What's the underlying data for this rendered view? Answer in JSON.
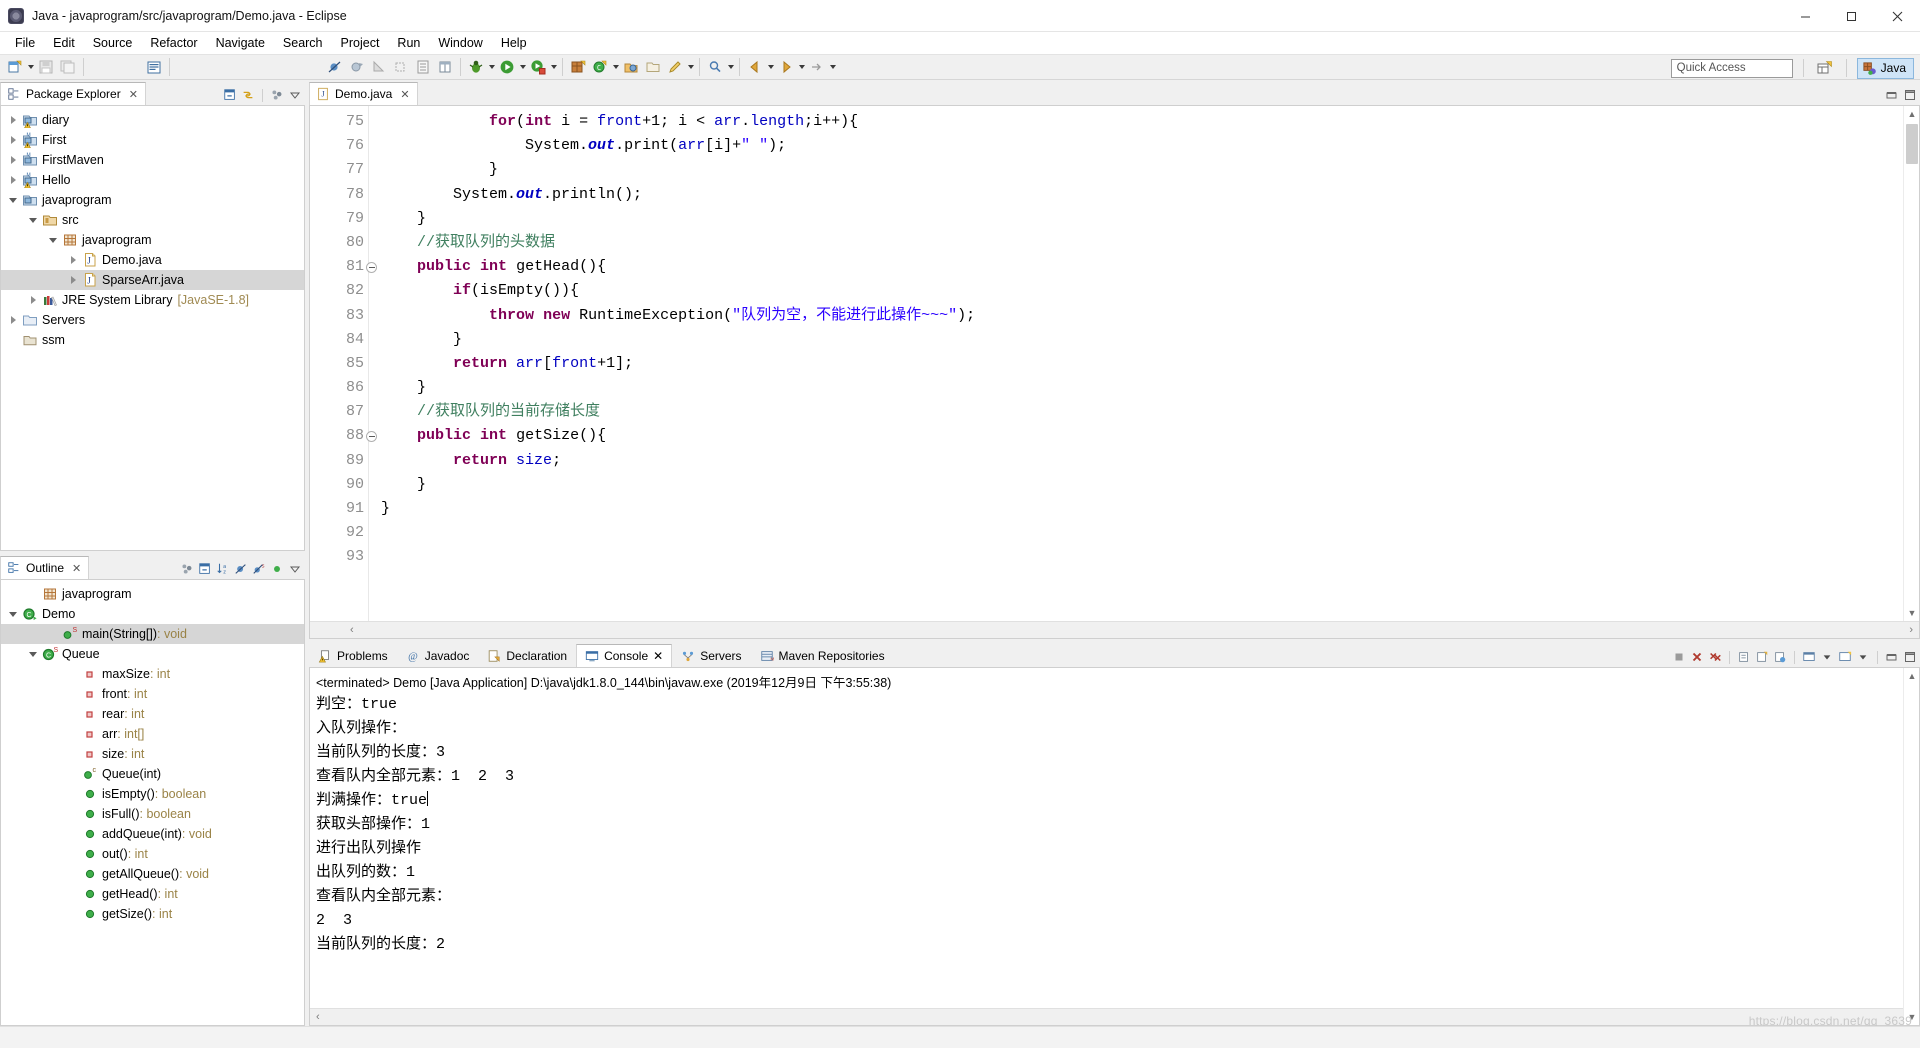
{
  "window": {
    "title": "Java - javaprogram/src/javaprogram/Demo.java - Eclipse",
    "app_icon": "eclipse-icon",
    "minimize": "minimize-button",
    "maximize": "maximize-button",
    "close": "close-button"
  },
  "menubar": {
    "items": [
      "File",
      "Edit",
      "Source",
      "Refactor",
      "Navigate",
      "Search",
      "Project",
      "Run",
      "Window",
      "Help"
    ]
  },
  "toolbar": {
    "quick_access_placeholder": "Quick Access",
    "quick_access_value": "",
    "perspective_open_label": "open-perspective",
    "perspective_java_label": "Java"
  },
  "package_explorer": {
    "tab_label": "Package Explorer",
    "tree": [
      {
        "label": "diary",
        "indent": 0,
        "twist": "closed",
        "icon": "java-project-warning-icon"
      },
      {
        "label": "First",
        "indent": 0,
        "twist": "closed",
        "icon": "maven-project-warning-icon"
      },
      {
        "label": "FirstMaven",
        "indent": 0,
        "twist": "closed",
        "icon": "maven-project-icon"
      },
      {
        "label": "Hello",
        "indent": 0,
        "twist": "closed",
        "icon": "maven-project-warning-icon"
      },
      {
        "label": "javaprogram",
        "indent": 0,
        "twist": "open",
        "icon": "java-project-icon"
      },
      {
        "label": "src",
        "indent": 1,
        "twist": "open",
        "icon": "source-folder-icon"
      },
      {
        "label": "javaprogram",
        "indent": 2,
        "twist": "open",
        "icon": "package-icon"
      },
      {
        "label": "Demo.java",
        "indent": 3,
        "twist": "closed",
        "icon": "java-file-icon"
      },
      {
        "label": "SparseArr.java",
        "indent": 3,
        "twist": "closed",
        "icon": "java-file-icon",
        "selected": true
      },
      {
        "label": "JRE System Library",
        "indent": 1,
        "twist": "closed",
        "icon": "library-icon",
        "sub": "[JavaSE-1.8]"
      },
      {
        "label": "Servers",
        "indent": 0,
        "twist": "closed",
        "icon": "folder-icon"
      },
      {
        "label": "ssm",
        "indent": 0,
        "twist": "none",
        "icon": "closed-project-icon"
      }
    ]
  },
  "outline": {
    "tab_label": "Outline",
    "tree": [
      {
        "label": "javaprogram",
        "indent": 1,
        "twist": "none",
        "icon": "package-icon"
      },
      {
        "label": "Demo",
        "indent": 0,
        "twist": "open",
        "icon": "class-icon"
      },
      {
        "label": "main(String[])",
        "type": " : void",
        "indent": 2,
        "twist": "none",
        "icon": "public-static-method-icon",
        "selected": true
      },
      {
        "label": "Queue",
        "indent": 1,
        "twist": "open",
        "icon": "static-class-icon"
      },
      {
        "label": "maxSize",
        "type": " : int",
        "indent": 3,
        "twist": "none",
        "icon": "private-field-icon"
      },
      {
        "label": "front",
        "type": " : int",
        "indent": 3,
        "twist": "none",
        "icon": "private-field-icon"
      },
      {
        "label": "rear",
        "type": " : int",
        "indent": 3,
        "twist": "none",
        "icon": "private-field-icon"
      },
      {
        "label": "arr",
        "type": " : int[]",
        "indent": 3,
        "twist": "none",
        "icon": "private-field-icon"
      },
      {
        "label": "size",
        "type": " : int",
        "indent": 3,
        "twist": "none",
        "icon": "private-field-icon"
      },
      {
        "label": "Queue(int)",
        "type": "",
        "indent": 3,
        "twist": "none",
        "icon": "constructor-icon"
      },
      {
        "label": "isEmpty()",
        "type": " : boolean",
        "indent": 3,
        "twist": "none",
        "icon": "public-method-icon"
      },
      {
        "label": "isFull()",
        "type": " : boolean",
        "indent": 3,
        "twist": "none",
        "icon": "public-method-icon"
      },
      {
        "label": "addQueue(int)",
        "type": " : void",
        "indent": 3,
        "twist": "none",
        "icon": "public-method-icon"
      },
      {
        "label": "out()",
        "type": " : int",
        "indent": 3,
        "twist": "none",
        "icon": "public-method-icon"
      },
      {
        "label": "getAllQueue()",
        "type": " : void",
        "indent": 3,
        "twist": "none",
        "icon": "public-method-icon"
      },
      {
        "label": "getHead()",
        "type": " : int",
        "indent": 3,
        "twist": "none",
        "icon": "public-method-icon"
      },
      {
        "label": "getSize()",
        "type": " : int",
        "indent": 3,
        "twist": "none",
        "icon": "public-method-icon"
      }
    ]
  },
  "editor": {
    "tab_label": "Demo.java",
    "first_line": 75,
    "lines": [
      {
        "n": 75,
        "fold": false,
        "tokens": [
          {
            "t": "            ",
            "c": "plain"
          },
          {
            "t": "for",
            "c": "kw"
          },
          {
            "t": "(",
            "c": "plain"
          },
          {
            "t": "int",
            "c": "kw"
          },
          {
            "t": " i = ",
            "c": "plain"
          },
          {
            "t": "front",
            "c": "fld"
          },
          {
            "t": "+1; i < ",
            "c": "plain"
          },
          {
            "t": "arr",
            "c": "fld"
          },
          {
            "t": ".",
            "c": "plain"
          },
          {
            "t": "length",
            "c": "fld"
          },
          {
            "t": ";i++){",
            "c": "plain"
          }
        ]
      },
      {
        "n": 76,
        "fold": false,
        "tokens": [
          {
            "t": "                System.",
            "c": "plain"
          },
          {
            "t": "out",
            "c": "stat"
          },
          {
            "t": ".print(",
            "c": "plain"
          },
          {
            "t": "arr",
            "c": "fld"
          },
          {
            "t": "[i]+",
            "c": "plain"
          },
          {
            "t": "\" \"",
            "c": "str"
          },
          {
            "t": ");",
            "c": "plain"
          }
        ]
      },
      {
        "n": 77,
        "fold": false,
        "tokens": [
          {
            "t": "            }",
            "c": "plain"
          }
        ]
      },
      {
        "n": 78,
        "fold": false,
        "tokens": [
          {
            "t": "        System.",
            "c": "plain"
          },
          {
            "t": "out",
            "c": "stat"
          },
          {
            "t": ".println();",
            "c": "plain"
          }
        ]
      },
      {
        "n": 79,
        "fold": false,
        "tokens": [
          {
            "t": "    }",
            "c": "plain"
          }
        ]
      },
      {
        "n": 80,
        "fold": false,
        "tokens": [
          {
            "t": "    //获取队列的头数据",
            "c": "cm"
          }
        ]
      },
      {
        "n": 81,
        "fold": true,
        "tokens": [
          {
            "t": "    ",
            "c": "plain"
          },
          {
            "t": "public",
            "c": "kw"
          },
          {
            "t": " ",
            "c": "plain"
          },
          {
            "t": "int",
            "c": "kw"
          },
          {
            "t": " getHead(){",
            "c": "plain"
          }
        ]
      },
      {
        "n": 82,
        "fold": false,
        "tokens": [
          {
            "t": "        ",
            "c": "plain"
          },
          {
            "t": "if",
            "c": "kw"
          },
          {
            "t": "(isEmpty()){",
            "c": "plain"
          }
        ]
      },
      {
        "n": 83,
        "fold": false,
        "tokens": [
          {
            "t": "            ",
            "c": "plain"
          },
          {
            "t": "throw",
            "c": "kw"
          },
          {
            "t": " ",
            "c": "plain"
          },
          {
            "t": "new",
            "c": "kw"
          },
          {
            "t": " RuntimeException(",
            "c": "plain"
          },
          {
            "t": "\"队列为空，不能进行此操作~~~\"",
            "c": "str"
          },
          {
            "t": ");",
            "c": "plain"
          }
        ]
      },
      {
        "n": 84,
        "fold": false,
        "tokens": [
          {
            "t": "        }",
            "c": "plain"
          }
        ]
      },
      {
        "n": 85,
        "fold": false,
        "tokens": [
          {
            "t": "        ",
            "c": "plain"
          },
          {
            "t": "return",
            "c": "kw"
          },
          {
            "t": " ",
            "c": "plain"
          },
          {
            "t": "arr",
            "c": "fld"
          },
          {
            "t": "[",
            "c": "plain"
          },
          {
            "t": "front",
            "c": "fld"
          },
          {
            "t": "+1];",
            "c": "plain"
          }
        ]
      },
      {
        "n": 86,
        "fold": false,
        "tokens": [
          {
            "t": "    }",
            "c": "plain"
          }
        ]
      },
      {
        "n": 87,
        "fold": false,
        "tokens": [
          {
            "t": "    //获取队列的当前存储长度",
            "c": "cm"
          }
        ]
      },
      {
        "n": 88,
        "fold": true,
        "tokens": [
          {
            "t": "    ",
            "c": "plain"
          },
          {
            "t": "public",
            "c": "kw"
          },
          {
            "t": " ",
            "c": "plain"
          },
          {
            "t": "int",
            "c": "kw"
          },
          {
            "t": " getSize(){",
            "c": "plain"
          }
        ]
      },
      {
        "n": 89,
        "fold": false,
        "tokens": [
          {
            "t": "        ",
            "c": "plain"
          },
          {
            "t": "return",
            "c": "kw"
          },
          {
            "t": " ",
            "c": "plain"
          },
          {
            "t": "size",
            "c": "fld"
          },
          {
            "t": ";",
            "c": "plain"
          }
        ]
      },
      {
        "n": 90,
        "fold": false,
        "tokens": [
          {
            "t": "    }",
            "c": "plain"
          }
        ]
      },
      {
        "n": 91,
        "fold": false,
        "tokens": [
          {
            "t": "}",
            "c": "plain"
          }
        ]
      },
      {
        "n": 92,
        "fold": false,
        "tokens": [
          {
            "t": "",
            "c": "plain"
          }
        ]
      },
      {
        "n": 93,
        "fold": false,
        "tokens": [
          {
            "t": "",
            "c": "plain"
          }
        ]
      }
    ]
  },
  "bottom_panel": {
    "tabs": [
      {
        "label": "Problems",
        "icon": "problems-icon",
        "active": false
      },
      {
        "label": "Javadoc",
        "icon": "javadoc-icon",
        "active": false
      },
      {
        "label": "Declaration",
        "icon": "declaration-icon",
        "active": false
      },
      {
        "label": "Console",
        "icon": "console-icon",
        "active": true
      },
      {
        "label": "Servers",
        "icon": "servers-icon",
        "active": false
      },
      {
        "label": "Maven Repositories",
        "icon": "maven-icon",
        "active": false
      }
    ],
    "console_header": "<terminated> Demo [Java Application] D:\\java\\jdk1.8.0_144\\bin\\javaw.exe (2019年12月9日 下午3:55:38)",
    "console_lines": [
      "判空：true",
      "入队列操作：",
      "当前队列的长度：3",
      "查看队内全部元素：1  2  3",
      "判满操作：true",
      "获取头部操作：1",
      "进行出队列操作",
      "出队列的数：1",
      "查看队内全部元素：",
      "2  3",
      "当前队列的长度：2"
    ],
    "caret_after_line_index": 4
  },
  "watermark": "https://blog.csdn.net/qq_3639"
}
